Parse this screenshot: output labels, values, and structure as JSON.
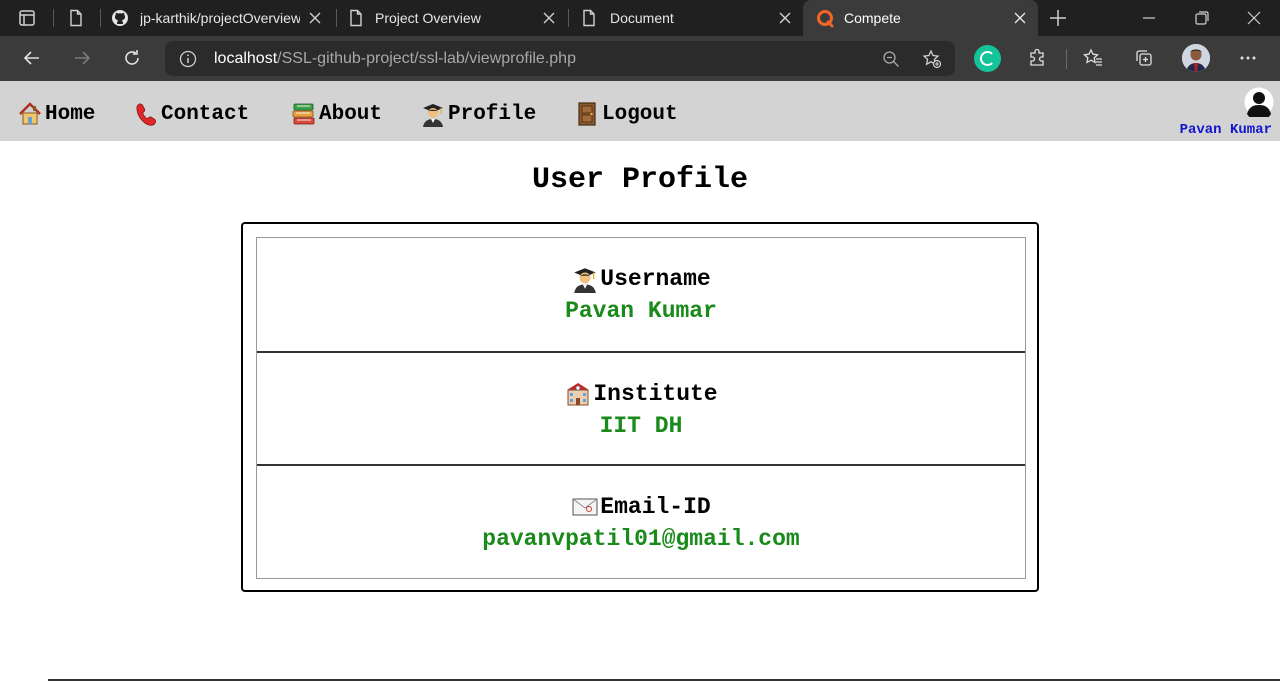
{
  "browser": {
    "tabs": [
      {
        "title": "jp-karthik/projectOverview",
        "icon": "github-icon"
      },
      {
        "title": "Project Overview",
        "icon": "page-icon"
      },
      {
        "title": "Document",
        "icon": "page-icon"
      },
      {
        "title": "Compete",
        "icon": "compete-icon",
        "active": true
      }
    ],
    "url_host": "localhost",
    "url_path": "/SSL-github-project/ssl-lab/viewprofile.php"
  },
  "nav": {
    "items": [
      {
        "label": "Home",
        "icon": "house-icon"
      },
      {
        "label": "Contact",
        "icon": "telephone-icon"
      },
      {
        "label": "About",
        "icon": "books-icon"
      },
      {
        "label": "Profile",
        "icon": "student-icon"
      },
      {
        "label": "Logout",
        "icon": "door-icon"
      }
    ],
    "user_name": "Pavan Kumar"
  },
  "profile": {
    "title": "User Profile",
    "fields": [
      {
        "label": "Username",
        "value": "Pavan Kumar",
        "icon": "student-icon"
      },
      {
        "label": "Institute",
        "value": "IIT DH",
        "icon": "school-icon"
      },
      {
        "label": "Email-ID",
        "value": "pavanvpatil01@gmail.com",
        "icon": "envelope-icon"
      }
    ]
  },
  "colors": {
    "nav_bg": "#d3d3d3",
    "value_green": "#1a8a1a",
    "user_blue": "#1515cc",
    "browser_dark": "#202020",
    "toolbar": "#3b3b3b"
  }
}
